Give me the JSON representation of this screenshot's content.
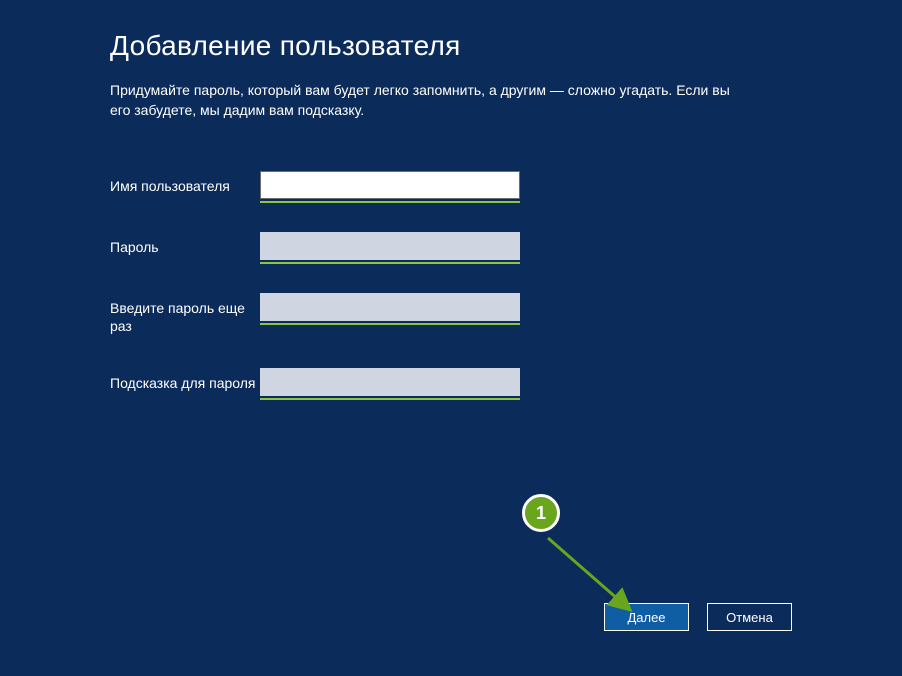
{
  "heading": "Добавление пользователя",
  "description": "Придумайте пароль, который вам будет легко запомнить, а другим — сложно угадать. Если вы его забудете, мы дадим вам подсказку.",
  "fields": {
    "username": {
      "label": "Имя пользователя",
      "value": ""
    },
    "password": {
      "label": "Пароль",
      "value": ""
    },
    "password_confirm": {
      "label": "Введите пароль еще раз",
      "value": ""
    },
    "hint": {
      "label": "Подсказка для пароля",
      "value": ""
    }
  },
  "buttons": {
    "next": "Далее",
    "cancel": "Отмена"
  },
  "annotation": {
    "step_number": "1"
  }
}
